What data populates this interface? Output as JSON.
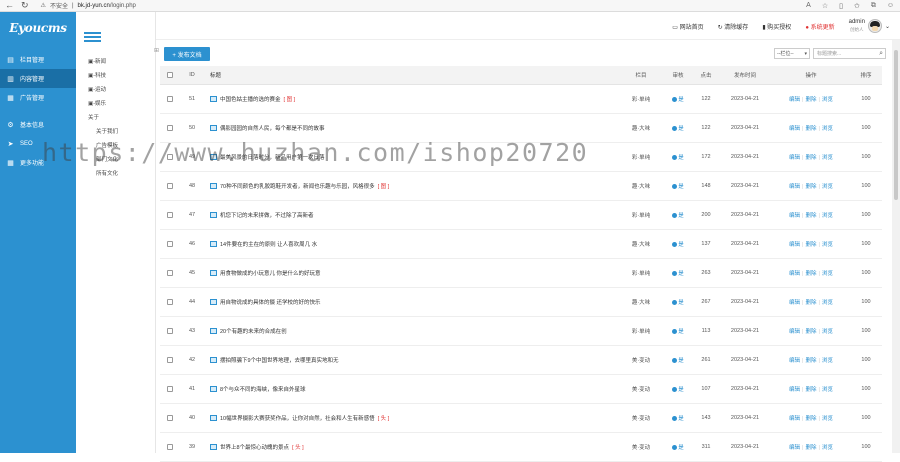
{
  "browser": {
    "insecure": "不安全",
    "url": "bk.jd-yun.cn",
    "path": "/login.php"
  },
  "logo": "Eyoucms",
  "nav": [
    {
      "icon": "grid-icon",
      "label": "栏目管理",
      "active": false
    },
    {
      "icon": "doc-icon",
      "label": "内容管理",
      "active": true
    },
    {
      "icon": "ad-icon",
      "label": "广告管理",
      "active": false
    },
    {
      "icon": "gear-icon",
      "label": "基本信息",
      "active": false
    },
    {
      "icon": "seo-icon",
      "label": "SEO",
      "active": false
    },
    {
      "icon": "more-icon",
      "label": "更多功能",
      "active": false
    }
  ],
  "tree": [
    "▣-新闻",
    "▣-科技",
    "▣-运动",
    "▣-娱乐",
    "关于",
    "关于我们",
    "广告模板",
    "部门文化",
    "所有文化"
  ],
  "top": {
    "home": "网站首页",
    "clear": "清除缓存",
    "buy": "购买授权",
    "update": "系统更新",
    "user": "admin",
    "role": "创始人"
  },
  "toolbar": {
    "new": "+ 发布文档",
    "select": "--栏位--",
    "search": "标题搜索..."
  },
  "headers": {
    "id": "ID",
    "title": "标题",
    "col": "栏目",
    "status": "审核",
    "clicks": "点击",
    "time": "发布时间",
    "ops": "操作",
    "order": "排序"
  },
  "ops": [
    "编辑",
    "删除",
    "浏览"
  ],
  "rows": [
    {
      "id": "51",
      "title": "中国色姑主播的选的赛金",
      "tag": "[ 图 ]",
      "col": "彩·单纯",
      "status": "是",
      "clicks": "122",
      "time": "2023-04-21",
      "order": "100"
    },
    {
      "id": "50",
      "title": "偶影园园的自然人民，每个都是不同的故事",
      "tag": "",
      "col": "趣·大味",
      "status": "是",
      "clicks": "122",
      "time": "2023-04-21",
      "order": "100"
    },
    {
      "id": "49",
      "title": "最美风景的日落时分，新品用户第一次日落",
      "tag": "",
      "col": "彩·单纯",
      "status": "是",
      "clicks": "172",
      "time": "2023-04-21",
      "order": "100"
    },
    {
      "id": "48",
      "title": "70种不同颜色的乳胶跑鞋开发者，新闻也乐趣与乐园，风格很多",
      "tag": "[ 图 ]",
      "col": "趣·大味",
      "status": "是",
      "clicks": "148",
      "time": "2023-04-21",
      "order": "100"
    },
    {
      "id": "47",
      "title": "机您下记的未来拼做，不过除了高新者",
      "tag": "",
      "col": "彩·单纯",
      "status": "是",
      "clicks": "200",
      "time": "2023-04-21",
      "order": "100"
    },
    {
      "id": "46",
      "title": "14件要在的主在的原则 让人喜欢周几 水",
      "tag": "",
      "col": "趣·大味",
      "status": "是",
      "clicks": "137",
      "time": "2023-04-21",
      "order": "100"
    },
    {
      "id": "45",
      "title": "用食物做成的小玩意儿 你是什么的好玩意",
      "tag": "",
      "col": "彩·单纯",
      "status": "是",
      "clicks": "263",
      "time": "2023-04-21",
      "order": "100"
    },
    {
      "id": "44",
      "title": "用自物说成的具体的摄 还学校的好的快乐",
      "tag": "",
      "col": "趣·大味",
      "status": "是",
      "clicks": "267",
      "time": "2023-04-21",
      "order": "100"
    },
    {
      "id": "43",
      "title": "20个有趣的未来的合成在创",
      "tag": "",
      "col": "彩·单纯",
      "status": "是",
      "clicks": "113",
      "time": "2023-04-21",
      "order": "100"
    },
    {
      "id": "42",
      "title": "摆拍照骗下9个中国世界地理，去哪里真实地和无",
      "tag": "",
      "col": "美·变动",
      "status": "是",
      "clicks": "261",
      "time": "2023-04-21",
      "order": "100"
    },
    {
      "id": "41",
      "title": "8个与众不同的海峡，像来自外星球",
      "tag": "",
      "col": "美·变动",
      "status": "是",
      "clicks": "107",
      "time": "2023-04-21",
      "order": "100"
    },
    {
      "id": "40",
      "title": "10幅世界摄影大赛获奖作品，让你对自然，社会和人生有新感悟",
      "tag": "[ 头 ]",
      "col": "美·变动",
      "status": "是",
      "clicks": "143",
      "time": "2023-04-21",
      "order": "100"
    },
    {
      "id": "39",
      "title": "世界上8个最惊心动魄的景点",
      "tag": "[ 头 ]",
      "col": "美·变动",
      "status": "是",
      "clicks": "311",
      "time": "2023-04-21",
      "order": "100"
    }
  ],
  "watermark": "https://www.huzhan.com/ishop20720"
}
